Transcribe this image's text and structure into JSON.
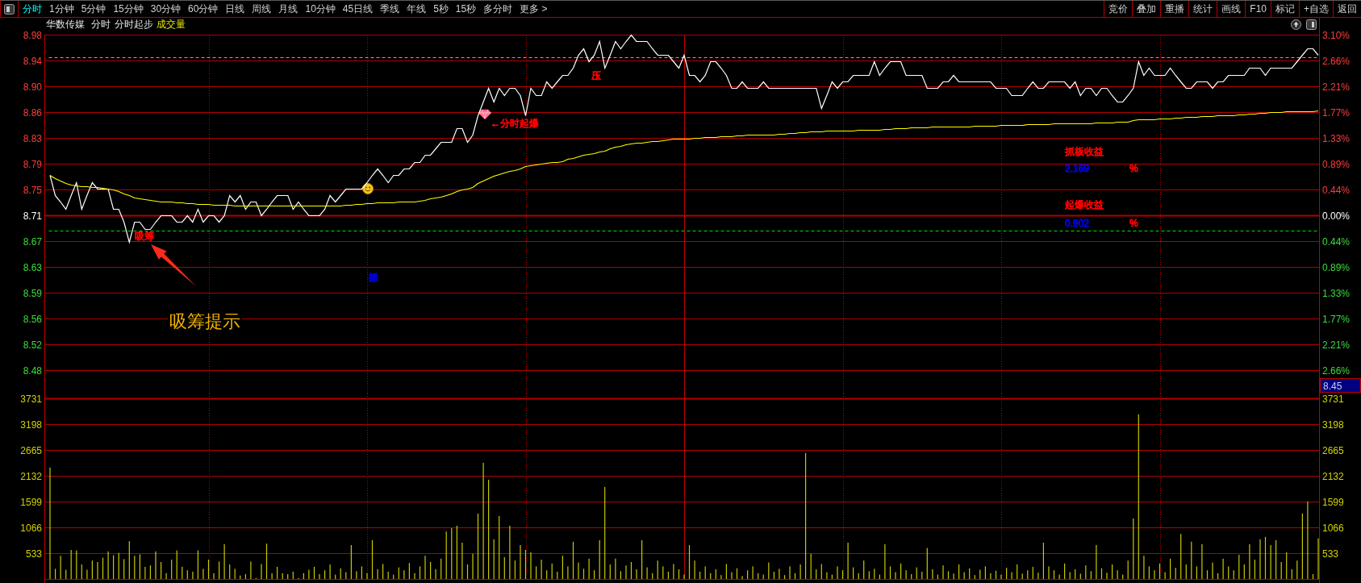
{
  "toolbar": {
    "tabs": [
      {
        "label": "分时",
        "selected": true
      },
      {
        "label": "1分钟",
        "selected": false
      },
      {
        "label": "5分钟",
        "selected": false
      },
      {
        "label": "15分钟",
        "selected": false
      },
      {
        "label": "30分钟",
        "selected": false
      },
      {
        "label": "60分钟",
        "selected": false
      },
      {
        "label": "日线",
        "selected": false
      },
      {
        "label": "周线",
        "selected": false
      },
      {
        "label": "月线",
        "selected": false
      },
      {
        "label": "10分钟",
        "selected": false
      },
      {
        "label": "45日线",
        "selected": false
      },
      {
        "label": "季线",
        "selected": false
      },
      {
        "label": "年线",
        "selected": false
      },
      {
        "label": "5秒",
        "selected": false
      },
      {
        "label": "15秒",
        "selected": false
      },
      {
        "label": "多分时",
        "selected": false
      },
      {
        "label": "更多 >",
        "selected": false
      }
    ],
    "buttons": [
      "竞价",
      "叠加",
      "重播",
      "统计",
      "画线",
      "F10",
      "标记",
      "+自选",
      "返回"
    ]
  },
  "header": {
    "stock_name": "华数传媒",
    "period": "分时",
    "indicator": "分时起步",
    "volume_label": "成交量"
  },
  "price_chart": {
    "chart_data": {
      "type": "line",
      "grid": true,
      "ylim": [
        8.4786,
        8.98
      ],
      "categories": [
        null,
        null,
        null,
        null,
        null,
        null,
        null,
        null,
        null,
        null,
        null,
        null,
        null,
        null,
        null,
        null,
        null,
        null,
        null,
        null,
        null,
        null,
        null,
        null,
        null,
        null,
        null,
        null,
        null,
        null,
        null,
        null,
        null,
        null,
        null,
        null,
        null,
        null,
        null,
        null,
        null,
        null,
        null,
        null,
        null,
        null,
        null,
        null,
        null,
        null,
        null,
        null,
        null,
        null,
        null,
        null,
        null,
        null,
        null,
        null,
        null,
        null,
        null,
        null,
        null,
        null,
        null,
        null,
        null,
        null,
        null,
        null,
        null,
        null,
        null,
        null,
        null,
        null,
        null,
        null,
        null,
        null,
        null,
        null,
        null,
        null,
        null,
        null,
        null,
        null,
        null,
        null,
        null,
        null,
        null,
        null,
        null,
        null,
        null,
        null,
        null,
        null,
        null,
        null,
        null,
        null,
        null,
        null,
        null,
        null,
        null,
        null,
        null,
        null,
        null,
        null,
        null,
        null,
        null,
        null,
        null,
        null,
        null,
        null,
        null,
        null,
        null,
        null,
        null,
        null,
        null,
        null,
        null,
        null,
        null,
        null,
        null,
        null,
        null,
        null,
        null,
        null,
        null,
        null,
        null,
        null,
        null,
        null,
        null,
        null,
        null,
        null,
        null,
        null,
        null,
        null,
        null,
        null,
        null,
        null,
        null,
        null,
        null,
        null,
        null,
        null,
        null,
        null,
        null,
        null,
        null,
        null,
        null,
        null,
        null,
        null,
        null,
        null,
        null,
        null,
        null,
        null,
        null,
        null,
        null,
        null,
        null,
        null,
        null,
        null,
        null,
        null,
        null,
        null,
        null,
        null,
        null,
        null,
        null,
        null,
        null,
        null,
        null,
        null,
        null,
        null,
        null,
        null,
        null,
        null,
        null,
        null,
        null,
        null,
        null,
        null,
        null,
        null,
        null,
        null,
        null,
        null,
        null,
        null,
        null,
        null,
        null,
        null,
        null,
        null,
        null,
        null,
        null,
        null,
        null,
        null,
        null,
        null,
        null,
        null,
        null
      ],
      "series": [
        {
          "color": "#ffffff",
          "values": [
            8.77,
            8.74,
            8.73,
            8.72,
            8.74,
            8.76,
            8.72,
            8.74,
            8.76,
            8.75,
            8.75,
            8.75,
            8.72,
            8.72,
            8.7,
            8.67,
            8.7,
            8.7,
            8.69,
            8.69,
            8.7,
            8.71,
            8.71,
            8.71,
            8.7,
            8.7,
            8.71,
            8.7,
            8.72,
            8.7,
            8.71,
            8.71,
            8.7,
            8.71,
            8.74,
            8.73,
            8.74,
            8.72,
            8.73,
            8.73,
            8.71,
            8.72,
            8.73,
            8.74,
            8.74,
            8.74,
            8.72,
            8.73,
            8.72,
            8.71,
            8.71,
            8.71,
            8.72,
            8.74,
            8.73,
            8.74,
            8.75,
            8.75,
            8.75,
            8.75,
            8.76,
            8.77,
            8.78,
            8.77,
            8.76,
            8.77,
            8.77,
            8.78,
            8.78,
            8.79,
            8.79,
            8.8,
            8.8,
            8.81,
            8.82,
            8.82,
            8.82,
            8.84,
            8.84,
            8.82,
            8.83,
            8.86,
            8.88,
            8.9,
            8.88,
            8.9,
            8.89,
            8.9,
            8.9,
            8.89,
            8.86,
            8.9,
            8.89,
            8.89,
            8.91,
            8.9,
            8.91,
            8.92,
            8.92,
            8.93,
            8.95,
            8.96,
            8.94,
            8.95,
            8.97,
            8.93,
            8.95,
            8.97,
            8.96,
            8.97,
            8.98,
            8.97,
            8.97,
            8.97,
            8.96,
            8.95,
            8.95,
            8.95,
            8.94,
            8.93,
            8.95,
            8.92,
            8.92,
            8.91,
            8.92,
            8.94,
            8.94,
            8.93,
            8.92,
            8.9,
            8.9,
            8.91,
            8.9,
            8.9,
            8.9,
            8.91,
            8.9,
            8.9,
            8.9,
            8.9,
            8.9,
            8.9,
            8.9,
            8.9,
            8.9,
            8.9,
            8.87,
            8.89,
            8.91,
            8.9,
            8.91,
            8.91,
            8.92,
            8.92,
            8.92,
            8.92,
            8.94,
            8.92,
            8.93,
            8.94,
            8.94,
            8.94,
            8.92,
            8.92,
            8.92,
            8.92,
            8.9,
            8.9,
            8.9,
            8.91,
            8.91,
            8.92,
            8.91,
            8.91,
            8.91,
            8.91,
            8.91,
            8.91,
            8.91,
            8.9,
            8.9,
            8.9,
            8.89,
            8.89,
            8.89,
            8.9,
            8.91,
            8.9,
            8.9,
            8.91,
            8.91,
            8.91,
            8.91,
            8.9,
            8.91,
            8.89,
            8.9,
            8.9,
            8.89,
            8.9,
            8.9,
            8.89,
            8.88,
            8.88,
            8.89,
            8.9,
            8.94,
            8.92,
            8.93,
            8.92,
            8.92,
            8.92,
            8.93,
            8.92,
            8.91,
            8.9,
            8.9,
            8.91,
            8.91,
            8.91,
            8.9,
            8.91,
            8.91,
            8.92,
            8.92,
            8.92,
            8.92,
            8.93,
            8.93,
            8.93,
            8.92,
            8.93,
            8.93,
            8.93,
            8.93,
            8.93,
            8.94,
            8.95,
            8.96,
            8.96,
            8.95
          ]
        },
        {
          "color": "#ffff00",
          "values": [
            8.77,
            8.766,
            8.762,
            8.758,
            8.756,
            8.755,
            8.754,
            8.753,
            8.752,
            8.752,
            8.751,
            8.75,
            8.748,
            8.746,
            8.743,
            8.74,
            8.737,
            8.735,
            8.734,
            8.733,
            8.732,
            8.731,
            8.73,
            8.73,
            8.729,
            8.729,
            8.728,
            8.728,
            8.727,
            8.727,
            8.727,
            8.726,
            8.726,
            8.726,
            8.726,
            8.725,
            8.725,
            8.725,
            8.725,
            8.725,
            8.725,
            8.725,
            8.725,
            8.725,
            8.725,
            8.725,
            8.725,
            8.725,
            8.725,
            8.725,
            8.725,
            8.725,
            8.725,
            8.725,
            8.725,
            8.725,
            8.726,
            8.726,
            8.727,
            8.727,
            8.728,
            8.728,
            8.729,
            8.729,
            8.729,
            8.729,
            8.73,
            8.73,
            8.731,
            8.731,
            8.732,
            8.733,
            8.735,
            8.736,
            8.738,
            8.74,
            8.742,
            8.746,
            8.748,
            8.75,
            8.752,
            8.758,
            8.762,
            8.766,
            8.769,
            8.772,
            8.774,
            8.776,
            8.777,
            8.78,
            8.783,
            8.785,
            8.786,
            8.787,
            8.788,
            8.789,
            8.79,
            8.791,
            8.794,
            8.796,
            8.798,
            8.8,
            8.802,
            8.803,
            8.805,
            8.807,
            8.81,
            8.812,
            8.814,
            8.816,
            8.817,
            8.818,
            8.819,
            8.82,
            8.821,
            8.821,
            8.822,
            8.823,
            8.824,
            8.824,
            8.825,
            8.825,
            8.826,
            8.826,
            8.827,
            8.827,
            8.827,
            8.828,
            8.828,
            8.828,
            8.829,
            8.829,
            8.83,
            8.83,
            8.83,
            8.83,
            8.831,
            8.831,
            8.832,
            8.832,
            8.833,
            8.833,
            8.834,
            8.834,
            8.835,
            8.835,
            8.835,
            8.836,
            8.836,
            8.836,
            8.837,
            8.837,
            8.837,
            8.838,
            8.838,
            8.838,
            8.838,
            8.838,
            8.839,
            8.839,
            8.84,
            8.84,
            8.84,
            8.841,
            8.841,
            8.841,
            8.841,
            8.842,
            8.842,
            8.842,
            8.842,
            8.842,
            8.843,
            8.843,
            8.843,
            8.844,
            8.844,
            8.844,
            8.844,
            8.844,
            8.845,
            8.845,
            8.845,
            8.845,
            8.845,
            8.846,
            8.846,
            8.846,
            8.846,
            8.846,
            8.847,
            8.847,
            8.847,
            8.847,
            8.848,
            8.848,
            8.848,
            8.848,
            8.849,
            8.849,
            8.849,
            8.849,
            8.85,
            8.85,
            8.85,
            8.852,
            8.853,
            8.853,
            8.854,
            8.854,
            8.855,
            8.855,
            8.855,
            8.856,
            8.856,
            8.857,
            8.857,
            8.857,
            8.858,
            8.858,
            8.858,
            8.859,
            8.859,
            8.86,
            8.86,
            8.861,
            8.861,
            8.862,
            8.862,
            8.863,
            8.863,
            8.864,
            8.864,
            8.864,
            8.865,
            8.865,
            8.866,
            8.866,
            8.866,
            8.866,
            8.867
          ]
        }
      ],
      "yticks": [
        {
          "value": 8.98,
          "label": "8.98"
        },
        {
          "value": 8.9415,
          "label": "8.94"
        },
        {
          "value": 8.9029,
          "label": "8.90"
        },
        {
          "value": 8.8643,
          "label": "8.86"
        },
        {
          "value": 8.8258,
          "label": "8.83"
        },
        {
          "value": 8.7872,
          "label": "8.79"
        },
        {
          "value": 8.7486,
          "label": "8.75"
        },
        {
          "value": 8.71,
          "label": "8.71"
        },
        {
          "value": 8.6714,
          "label": "8.67"
        },
        {
          "value": 8.6328,
          "label": "8.63"
        },
        {
          "value": 8.5943,
          "label": "8.59"
        },
        {
          "value": 8.5557,
          "label": "8.56"
        },
        {
          "value": 8.5171,
          "label": "8.52"
        },
        {
          "value": 8.4786,
          "label": "8.48"
        }
      ],
      "ref_lines": [
        {
          "axis": "y",
          "value": 8.946,
          "color": "#ff8080"
        },
        {
          "axis": "y",
          "value": 8.71,
          "color": "#b40000"
        },
        {
          "axis": "y",
          "value": 8.687,
          "color": "#00e000"
        }
      ]
    },
    "pct_axis": [
      {
        "text": "3.10%",
        "kind": "up"
      },
      {
        "text": "2.66%",
        "kind": "up"
      },
      {
        "text": "2.21%",
        "kind": "up"
      },
      {
        "text": "1.77%",
        "kind": "up"
      },
      {
        "text": "1.33%",
        "kind": "up"
      },
      {
        "text": "0.89%",
        "kind": "up"
      },
      {
        "text": "0.44%",
        "kind": "up"
      },
      {
        "text": "0.00%",
        "kind": "flat"
      },
      {
        "text": "0.44%",
        "kind": "down"
      },
      {
        "text": "0.89%",
        "kind": "down"
      },
      {
        "text": "1.33%",
        "kind": "down"
      },
      {
        "text": "1.77%",
        "kind": "down"
      },
      {
        "text": "2.21%",
        "kind": "down"
      },
      {
        "text": "2.66%",
        "kind": "down"
      }
    ],
    "signals": [
      {
        "kind": "text",
        "text": "吸筹",
        "color": "#ff0000"
      },
      {
        "kind": "smiley"
      },
      {
        "kind": "text",
        "text": "抓",
        "color": "#0000ff"
      },
      {
        "kind": "gem"
      },
      {
        "kind": "text",
        "text": "←分时起爆",
        "color": "#ff0000"
      },
      {
        "kind": "text",
        "text": "压",
        "color": "#ff0000"
      },
      {
        "kind": "text",
        "text": "抓板收益",
        "color": "#ff0000"
      },
      {
        "kind": "text",
        "text": "2.169",
        "color": "#0000ff"
      },
      {
        "kind": "text",
        "text": "%",
        "color": "#ff0000"
      },
      {
        "kind": "text",
        "text": "起爆收益",
        "color": "#ff0000"
      },
      {
        "kind": "text",
        "text": "0.902",
        "color": "#0000ff"
      },
      {
        "kind": "text",
        "text": "%",
        "color": "#ff0000"
      }
    ],
    "cursor_price": "8.45",
    "callout": {
      "text": "吸筹提示"
    }
  },
  "volume_chart": {
    "chart_data": {
      "type": "bar",
      "grid": true,
      "ylim": [
        0,
        3731
      ],
      "yticks": [
        533,
        1066,
        1599,
        2132,
        2665,
        3198,
        3731
      ],
      "categories": [
        null,
        null,
        null,
        null,
        null,
        null,
        null,
        null,
        null,
        null,
        null,
        null,
        null,
        null,
        null,
        null,
        null,
        null,
        null,
        null,
        null,
        null,
        null,
        null,
        null,
        null,
        null,
        null,
        null,
        null,
        null,
        null,
        null,
        null,
        null,
        null,
        null,
        null,
        null,
        null,
        null,
        null,
        null,
        null,
        null,
        null,
        null,
        null,
        null,
        null,
        null,
        null,
        null,
        null,
        null,
        null,
        null,
        null,
        null,
        null,
        null,
        null,
        null,
        null,
        null,
        null,
        null,
        null,
        null,
        null,
        null,
        null,
        null,
        null,
        null,
        null,
        null,
        null,
        null,
        null,
        null,
        null,
        null,
        null,
        null,
        null,
        null,
        null,
        null,
        null,
        null,
        null,
        null,
        null,
        null,
        null,
        null,
        null,
        null,
        null,
        null,
        null,
        null,
        null,
        null,
        null,
        null,
        null,
        null,
        null,
        null,
        null,
        null,
        null,
        null,
        null,
        null,
        null,
        null,
        null,
        null,
        null,
        null,
        null,
        null,
        null,
        null,
        null,
        null,
        null,
        null,
        null,
        null,
        null,
        null,
        null,
        null,
        null,
        null,
        null,
        null,
        null,
        null,
        null,
        null,
        null,
        null,
        null,
        null,
        null,
        null,
        null,
        null,
        null,
        null,
        null,
        null,
        null,
        null,
        null,
        null,
        null,
        null,
        null,
        null,
        null,
        null,
        null,
        null,
        null,
        null,
        null,
        null,
        null,
        null,
        null,
        null,
        null,
        null,
        null,
        null,
        null,
        null,
        null,
        null,
        null,
        null,
        null,
        null,
        null,
        null,
        null,
        null,
        null,
        null,
        null,
        null,
        null,
        null,
        null,
        null,
        null,
        null,
        null,
        null,
        null,
        null,
        null,
        null,
        null,
        null,
        null,
        null,
        null,
        null,
        null,
        null,
        null,
        null,
        null,
        null,
        null,
        null,
        null,
        null,
        null,
        null,
        null,
        null,
        null,
        null,
        null,
        null,
        null,
        null,
        null,
        null,
        null,
        null,
        null,
        null
      ],
      "values": [
        2300,
        210,
        480,
        190,
        600,
        590,
        300,
        190,
        380,
        350,
        440,
        570,
        490,
        540,
        410,
        780,
        480,
        510,
        250,
        280,
        570,
        350,
        120,
        400,
        590,
        250,
        180,
        150,
        590,
        210,
        400,
        120,
        360,
        720,
        300,
        210,
        70,
        100,
        360,
        20,
        310,
        730,
        120,
        250,
        120,
        100,
        150,
        20,
        120,
        190,
        250,
        100,
        180,
        300,
        90,
        220,
        140,
        700,
        160,
        260,
        120,
        800,
        200,
        310,
        150,
        90,
        240,
        180,
        330,
        120,
        260,
        480,
        350,
        200,
        420,
        980,
        1050,
        1100,
        750,
        300,
        520,
        1350,
        2400,
        2050,
        820,
        1300,
        450,
        1100,
        380,
        700,
        600,
        550,
        260,
        400,
        180,
        320,
        150,
        480,
        260,
        770,
        340,
        210,
        420,
        180,
        800,
        1900,
        300,
        420,
        160,
        280,
        350,
        200,
        800,
        240,
        120,
        380,
        260,
        150,
        310,
        200,
        90,
        700,
        380,
        150,
        260,
        120,
        200,
        80,
        310,
        140,
        220,
        60,
        180,
        260,
        120,
        90,
        340,
        150,
        210,
        80,
        260,
        120,
        300,
        2600,
        520,
        200,
        310,
        140,
        90,
        260,
        180,
        750,
        240,
        120,
        380,
        160,
        210,
        90,
        720,
        260,
        140,
        320,
        180,
        100,
        240,
        150,
        640,
        200,
        90,
        280,
        160,
        110,
        300,
        140,
        220,
        80,
        190,
        260,
        120,
        170,
        90,
        230,
        140,
        300,
        110,
        180,
        250,
        130,
        750,
        260,
        180,
        90,
        320,
        140,
        200,
        110,
        280,
        160,
        700,
        220,
        130,
        300,
        180,
        90,
        380,
        1250,
        3400,
        480,
        260,
        180,
        320,
        140,
        420,
        230,
        930,
        300,
        770,
        260,
        720,
        180,
        340,
        120,
        420,
        260,
        180,
        500,
        300,
        720,
        400,
        820,
        870,
        700,
        800,
        350,
        550,
        200,
        380,
        1350,
        1600,
        100,
        840
      ]
    },
    "right_axis": [
      "3731",
      "3198",
      "2665",
      "2132",
      "1599",
      "1066",
      "533"
    ]
  }
}
